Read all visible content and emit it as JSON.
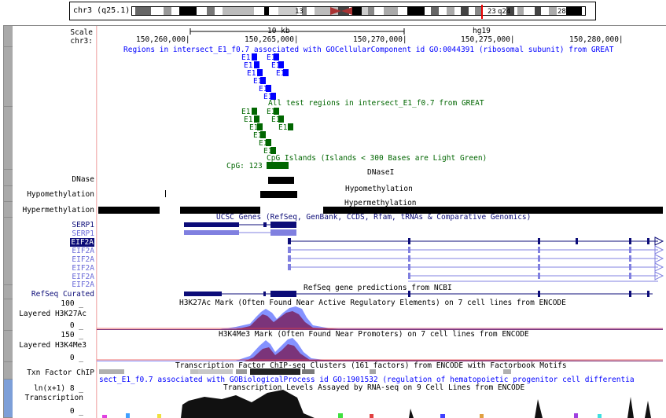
{
  "ideogram": {
    "label": "chr3 (q25.1)",
    "bands": [
      "13",
      "23",
      "q24",
      "28",
      "29"
    ]
  },
  "ruler": {
    "scale_label": "Scale",
    "chr_label": "chr3:",
    "scale_value": "10 kb",
    "assembly": "hg19",
    "ticks": [
      "150,260,000|",
      "150,265,000|",
      "150,270,000|",
      "150,275,000|",
      "150,280,000|"
    ]
  },
  "left_labels": {
    "dnase": "DNase",
    "hypomethylation": "Hypomethylation",
    "hypermethylation": "Hypermethylation",
    "refseq": "RefSeq Curated",
    "h3k27ac_max": "100 _",
    "h3k27ac_name": "Layered H3K27Ac",
    "h3k27ac_zero": "0 _",
    "h3k4me3_max": "150 _",
    "h3k4me3_name": "Layered H3K4Me3",
    "h3k4me3_zero": "0 _",
    "txn": "Txn Factor ChIP",
    "trans_max": "ln(x+1) 8 _",
    "trans_name": "Transcription",
    "trans_zero": "0 _"
  },
  "genes": [
    "SERP1",
    "SERP1",
    "EIF2A",
    "EIF2A",
    "EIF2A",
    "EIF2A",
    "EIF2A",
    "EIF2A"
  ],
  "tracks": {
    "great_cc": "Regions in intersect_E1_f0.7 associated with GOCellularComponent id GO:0044391 (ribosomal subunit) from GREAT",
    "all_test": "All test regions in intersect_E1_f0.7 from GREAT",
    "cpg": "CpG Islands (Islands < 300 Bases are Light Green)",
    "cpg_item": "CpG: 123",
    "dnase": "DNaseI",
    "hypo": "Hypomethylation",
    "hyper": "Hypermethylation",
    "ucsc_genes": "UCSC Genes (RefSeq, GenBank, CCDS, Rfam, tRNAs & Comparative Genomics)",
    "refseq": "RefSeq gene predictions from NCBI",
    "h3k27ac": "H3K27Ac Mark (Often Found Near Active Regulatory Elements) on 7 cell lines from ENCODE",
    "h3k4me3": "H3K4Me3 Mark (Often Found Near Promoters) on 7 cell lines from ENCODE",
    "txn": "Transcription Factor ChIP-seq Clusters (161 factors) from ENCODE with Factorbook Motifs",
    "great_bp": "sect_E1_f0.7 associated with GOBiologicalProcess id GO:1901532 (regulation of hematopoietic progenitor cell differentia",
    "trans": "Transcription Levels Assayed by RNA-seq on 9 Cell Lines from ENCODE",
    "element": "E1"
  },
  "colors": {
    "great_cc": "#0000ff",
    "great_all": "#006600",
    "gene": "#0c0c78",
    "gene_light": "#8080e0",
    "h3_purple": "#7a2a6b",
    "h3_blue": "#6f7fff",
    "highlight": "#f0a0a0"
  }
}
